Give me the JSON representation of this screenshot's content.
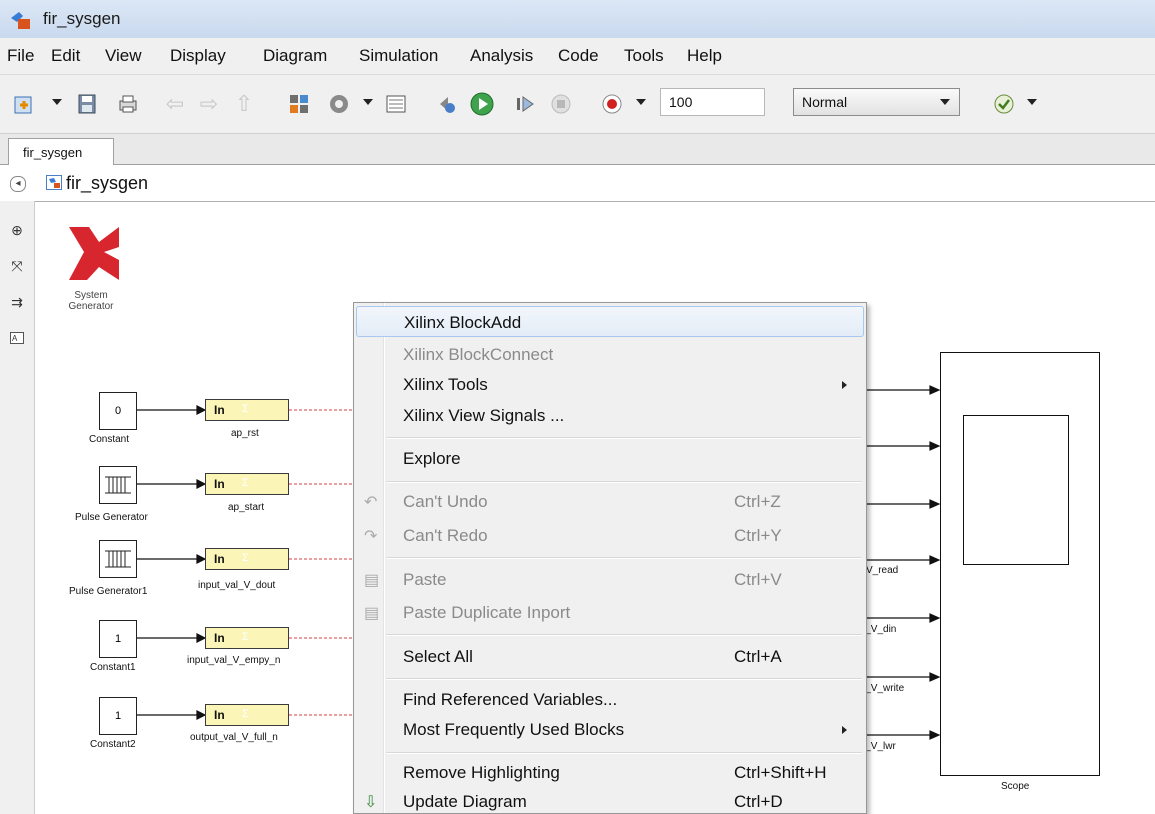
{
  "window": {
    "title": "fir_sysgen"
  },
  "menubar": [
    "File",
    "Edit",
    "View",
    "Display",
    "Diagram",
    "Simulation",
    "Analysis",
    "Code",
    "Tools",
    "Help"
  ],
  "toolbar": {
    "stop_time": "100",
    "sim_mode": "Normal",
    "icons": [
      "new-model-icon",
      "save-icon",
      "print-icon",
      "back-icon",
      "forward-icon",
      "up-icon",
      "library-browser-icon",
      "settings-gear-icon",
      "model-explorer-icon",
      "step-back-icon",
      "run-icon",
      "step-forward-icon",
      "stop-icon",
      "record-icon",
      "model-advisor-icon"
    ]
  },
  "tab": {
    "label": "fir_sysgen"
  },
  "breadcrumb": {
    "label": "fir_sysgen"
  },
  "canvas": {
    "system_generator_label": "System\nGenerator",
    "sources": [
      {
        "label": "Constant",
        "value": "0",
        "inport": "ap_rst"
      },
      {
        "label": "Pulse Generator",
        "value": "",
        "inport": "ap_start"
      },
      {
        "label": "Pulse Generator1",
        "value": "",
        "inport": "input_val_V_dout"
      },
      {
        "label": "Constant1",
        "value": "1",
        "inport": "input_val_V_empy_n"
      },
      {
        "label": "Constant2",
        "value": "1",
        "inport": "output_val_V_full_n"
      }
    ],
    "inport_text": "In",
    "signal_labels": [
      "V_read",
      "l_V_din",
      "l_V_write",
      "l_V_lwr"
    ],
    "scope_label": "Scope"
  },
  "context_menu": {
    "items": [
      {
        "label": "Xilinx BlockAdd",
        "shortcut": "",
        "disabled": false,
        "submenu": false,
        "highlighted": true
      },
      {
        "label": "Xilinx BlockConnect",
        "shortcut": "",
        "disabled": true,
        "submenu": false
      },
      {
        "label": "Xilinx Tools",
        "shortcut": "",
        "disabled": false,
        "submenu": true
      },
      {
        "label": "Xilinx View Signals ...",
        "shortcut": "",
        "disabled": false,
        "submenu": false
      },
      {
        "label": "Explore",
        "shortcut": "",
        "disabled": false,
        "submenu": false
      },
      {
        "label": "Can't Undo",
        "shortcut": "Ctrl+Z",
        "disabled": true,
        "submenu": false,
        "icon": "undo-icon"
      },
      {
        "label": "Can't Redo",
        "shortcut": "Ctrl+Y",
        "disabled": true,
        "submenu": false,
        "icon": "redo-icon"
      },
      {
        "label": "Paste",
        "shortcut": "Ctrl+V",
        "disabled": true,
        "submenu": false,
        "icon": "paste-icon"
      },
      {
        "label": "Paste Duplicate Inport",
        "shortcut": "",
        "disabled": true,
        "submenu": false,
        "icon": "paste-duplicate-icon"
      },
      {
        "label": "Select All",
        "shortcut": "Ctrl+A",
        "disabled": false,
        "submenu": false
      },
      {
        "label": "Find Referenced Variables...",
        "shortcut": "",
        "disabled": false,
        "submenu": false
      },
      {
        "label": "Most Frequently Used Blocks",
        "shortcut": "",
        "disabled": false,
        "submenu": true
      },
      {
        "label": "Remove Highlighting",
        "shortcut": "Ctrl+Shift+H",
        "disabled": false,
        "submenu": false
      },
      {
        "label": "Update Diagram",
        "shortcut": "Ctrl+D",
        "disabled": false,
        "submenu": false,
        "icon": "update-diagram-icon"
      }
    ]
  },
  "colors": {
    "inport_fill": "#fbf6b8",
    "xilinx_red": "#d8262f",
    "signal_dashed": "#d04040"
  }
}
